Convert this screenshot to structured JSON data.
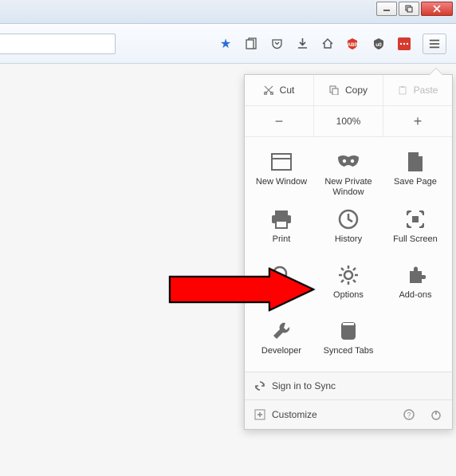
{
  "window": {
    "minimize": "_",
    "maximize": "▢",
    "close": "✕"
  },
  "toolbar": {
    "hamburger": "≡"
  },
  "edit": {
    "cut": "Cut",
    "copy": "Copy",
    "paste": "Paste"
  },
  "zoom": {
    "minus": "−",
    "value": "100%",
    "plus": "+"
  },
  "tools": {
    "newwindow": "New Window",
    "private": "New Private Window",
    "savepage": "Save Page",
    "print": "Print",
    "history": "History",
    "fullscreen": "Full Screen",
    "find": "Find",
    "options": "Options",
    "addons": "Add-ons",
    "developer": "Developer",
    "synced": "Synced Tabs"
  },
  "footer": {
    "signin": "Sign in to Sync",
    "customize": "Customize"
  }
}
